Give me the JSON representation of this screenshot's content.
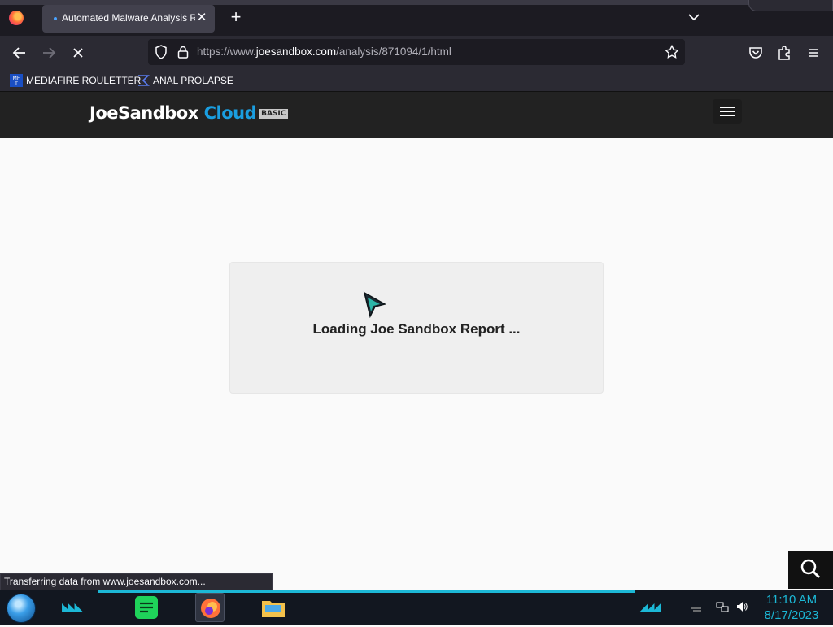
{
  "browser": {
    "tab": {
      "title": "Automated Malware Analysis R",
      "close_glyph": "✕"
    },
    "new_tab_glyph": "+",
    "url": {
      "scheme_prefix": "https://www.",
      "host": "joesandbox.com",
      "path": "/analysis/871094/1/html"
    },
    "bookmarks": [
      {
        "label": "MEDIAFIRE ROULETTER",
        "icon": "mediafire-icon"
      },
      {
        "label": "ANAL PROLAPSE",
        "icon": "sigma-icon"
      }
    ],
    "status_text": "Transferring data from www.joesandbox.com..."
  },
  "site": {
    "logo": {
      "joe": "Joe",
      "sandbox": "Sandbox",
      "cloud": "Cloud",
      "edition": "BASIC"
    },
    "loading_text": "Loading Joe Sandbox Report ..."
  },
  "taskbar": {
    "time": "11:10 AM",
    "date": "8/17/2023"
  },
  "colors": {
    "accent": "#1cb8d6",
    "cloud_blue": "#1a9ee0",
    "header_bg": "#222222"
  }
}
